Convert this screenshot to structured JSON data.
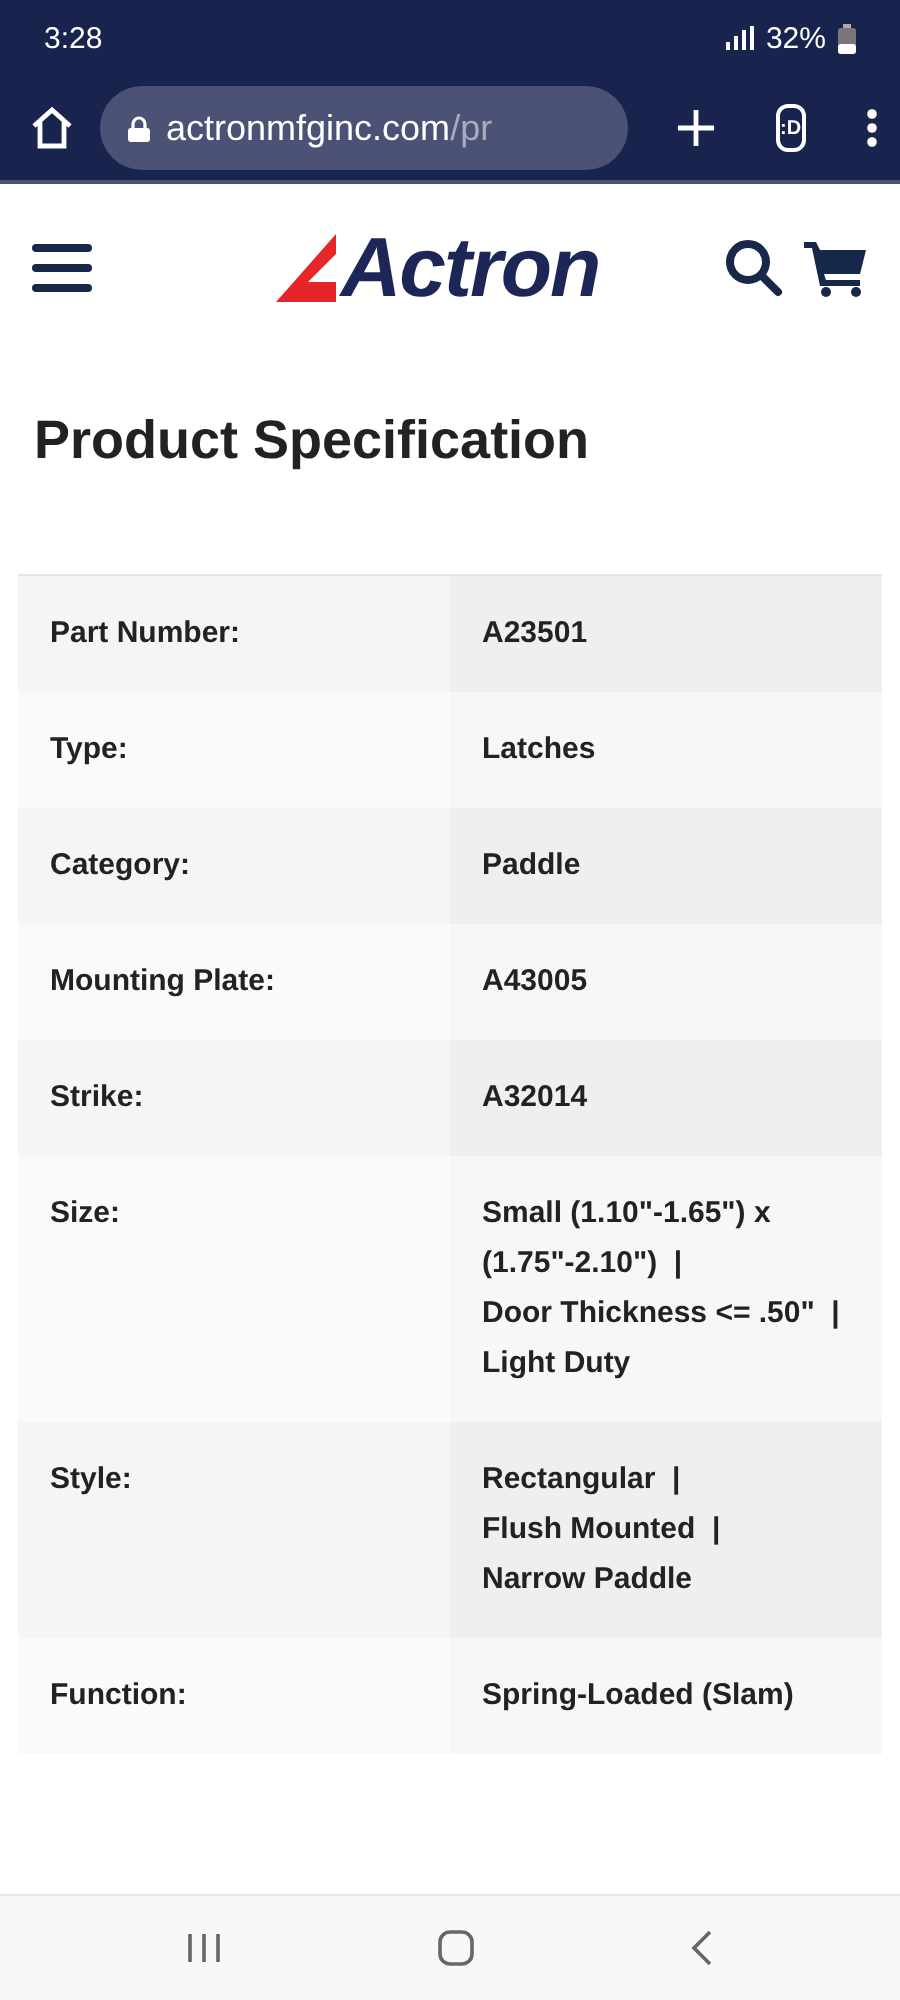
{
  "status_bar": {
    "time": "3:28",
    "battery": "32%"
  },
  "browser": {
    "url_host": "actronmfginc.com",
    "url_path": "/pr",
    "tab_switcher": ":D"
  },
  "site_header": {
    "logo": "Actron"
  },
  "title": "Product Specification",
  "specs": [
    {
      "label": "Part Number:",
      "values": [
        "A23501"
      ]
    },
    {
      "label": "Type:",
      "values": [
        "Latches"
      ]
    },
    {
      "label": "Category:",
      "values": [
        "Paddle"
      ]
    },
    {
      "label": "Mounting Plate:",
      "values": [
        "A43005"
      ]
    },
    {
      "label": "Strike:",
      "values": [
        "A32014"
      ]
    },
    {
      "label": "Size:",
      "values": [
        "Small (1.10\"-1.65\") x (1.75\"-2.10\")  |",
        "Door Thickness <= .50\"  |",
        "Light Duty"
      ]
    },
    {
      "label": "Style:",
      "values": [
        "Rectangular  |",
        "Flush Mounted  |",
        "Narrow Paddle"
      ]
    },
    {
      "label": "Function:",
      "values": [
        "Spring-Loaded (Slam)"
      ]
    }
  ]
}
